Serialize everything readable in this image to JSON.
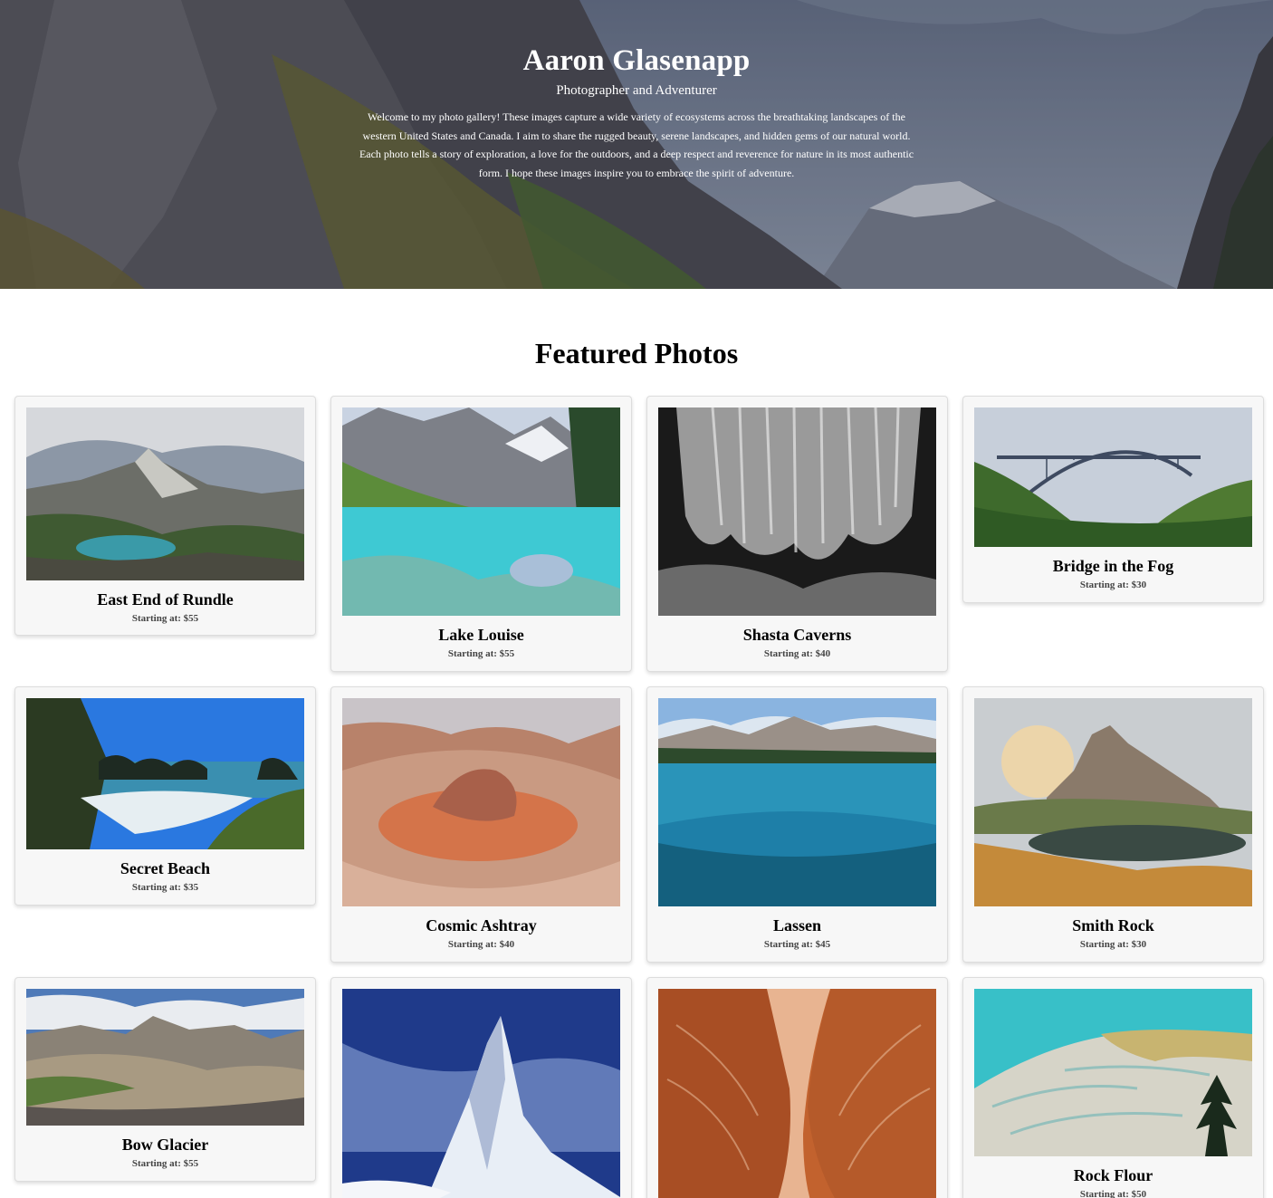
{
  "hero": {
    "title": "Aaron Glasenapp",
    "subtitle": "Photographer and Adventurer",
    "intro": "Welcome to my photo gallery! These images capture a wide variety of ecosystems across the breathtaking landscapes of the western United States and Canada. I aim to share the rugged beauty, serene landscapes, and hidden gems of our natural world. Each photo tells a story of exploration, a love for the outdoors, and a deep respect and reverence for nature in its most authentic form. I hope these images inspire you to embrace the spirit of adventure."
  },
  "featured": {
    "title": "Featured Photos",
    "photos": [
      {
        "name": "East End of Rundle",
        "price": "Starting at: $55"
      },
      {
        "name": "Lake Louise",
        "price": "Starting at: $55"
      },
      {
        "name": "Shasta Caverns",
        "price": "Starting at: $40"
      },
      {
        "name": "Bridge in the Fog",
        "price": "Starting at: $30"
      },
      {
        "name": "Secret Beach",
        "price": "Starting at: $35"
      },
      {
        "name": "Cosmic Ashtray",
        "price": "Starting at: $40"
      },
      {
        "name": "Lassen",
        "price": "Starting at: $45"
      },
      {
        "name": "Smith Rock",
        "price": "Starting at: $30"
      },
      {
        "name": "Bow Glacier",
        "price": "Starting at: $55"
      },
      {
        "name": "",
        "price": ""
      },
      {
        "name": "",
        "price": ""
      },
      {
        "name": "Rock Flour",
        "price": "Starting at: $50"
      }
    ]
  }
}
